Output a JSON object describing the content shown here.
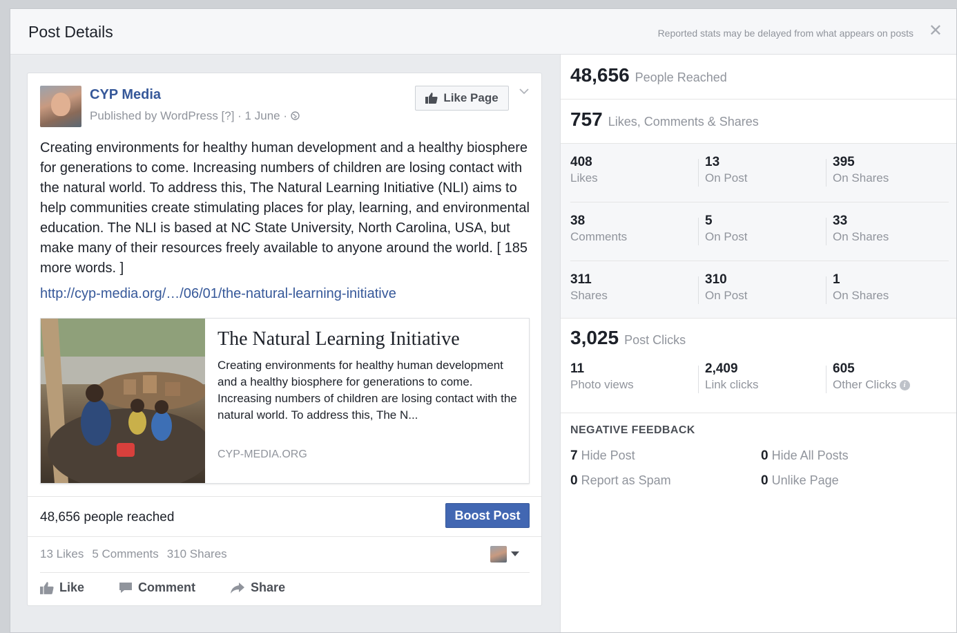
{
  "modal": {
    "title": "Post Details",
    "note": "Reported stats may be delayed from what appears on posts",
    "close": "✕"
  },
  "post": {
    "page_name": "CYP Media",
    "meta": "Published by WordPress [?] · 1 June · ",
    "like_page": "Like Page",
    "text": "Creating environments for healthy human development and a healthy biosphere for generations to come. Increasing numbers of children are losing contact with the natural world. To address this, The Natural Learning Initiative (NLI) aims to help communities create stimulating places for play, learning, and environmental education. The NLI is based at NC State University, North Carolina, USA, but make many of their resources freely available to anyone around the world. [ 185 more words. ]",
    "link": "http://cyp-media.org/…/06/01/the-natural-learning-initiative",
    "preview": {
      "title": "The Natural Learning Initiative",
      "description": "Creating environments for healthy human development and a healthy biosphere for generations to come. Increasing numbers of children are losing contact with the natural world. To address this, The N...",
      "domain": "CYP-MEDIA.ORG"
    },
    "reached": "48,656 people reached",
    "boost": "Boost Post",
    "counts": {
      "likes": "13 Likes",
      "comments": "5 Comments",
      "shares": "310 Shares"
    },
    "actions": {
      "like": "Like",
      "comment": "Comment",
      "share": "Share"
    }
  },
  "stats": {
    "reached": {
      "num": "48,656",
      "label": "People Reached"
    },
    "engagement": {
      "num": "757",
      "label": "Likes, Comments & Shares"
    },
    "rows": [
      [
        {
          "num": "408",
          "label": "Likes"
        },
        {
          "num": "13",
          "label": "On Post"
        },
        {
          "num": "395",
          "label": "On Shares"
        }
      ],
      [
        {
          "num": "38",
          "label": "Comments"
        },
        {
          "num": "5",
          "label": "On Post"
        },
        {
          "num": "33",
          "label": "On Shares"
        }
      ],
      [
        {
          "num": "311",
          "label": "Shares"
        },
        {
          "num": "310",
          "label": "On Post"
        },
        {
          "num": "1",
          "label": "On Shares"
        }
      ]
    ],
    "clicks": {
      "num": "3,025",
      "label": "Post Clicks"
    },
    "click_row": [
      {
        "num": "11",
        "label": "Photo views"
      },
      {
        "num": "2,409",
        "label": "Link clicks"
      },
      {
        "num": "605",
        "label": "Other Clicks"
      }
    ],
    "negative": {
      "title": "NEGATIVE FEEDBACK",
      "hide_post": {
        "num": "7",
        "label": "Hide Post"
      },
      "hide_all": {
        "num": "0",
        "label": "Hide All Posts"
      },
      "spam": {
        "num": "0",
        "label": "Report as Spam"
      },
      "unlike": {
        "num": "0",
        "label": "Unlike Page"
      }
    }
  }
}
